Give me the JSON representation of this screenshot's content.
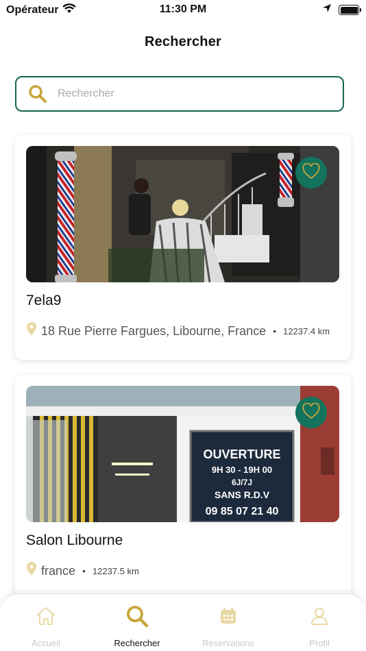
{
  "status_bar": {
    "carrier": "Opérateur",
    "time": "11:30 PM"
  },
  "header": {
    "title": "Rechercher"
  },
  "search": {
    "placeholder": "Rechercher",
    "value": ""
  },
  "salons": [
    {
      "name": "7ela9",
      "address": "18 Rue Pierre Fargues, Libourne, France",
      "separator": "•",
      "distance": "12237.4 km",
      "favorite": false,
      "photo_icon": "barbershop-photo"
    },
    {
      "name": "Salon Libourne",
      "address": "france",
      "separator": "•",
      "distance": "12237.5 km",
      "favorite": false,
      "photo_icon": "storefront-photo",
      "sign": {
        "line1": "OUVERTURE",
        "line2": "9H 30 - 19H 00",
        "line3": "6J/7J",
        "line4": "SANS R.D.V",
        "line5": "09 85 07 21 40"
      }
    }
  ],
  "tab_bar": {
    "items": [
      {
        "label": "Accueil",
        "icon": "home-icon",
        "active": false
      },
      {
        "label": "Rechercher",
        "icon": "search-icon",
        "active": true
      },
      {
        "label": "Réservations",
        "icon": "calendar-icon",
        "active": false
      },
      {
        "label": "Profil",
        "icon": "user-icon",
        "active": false
      }
    ]
  },
  "colors": {
    "accent_green": "#13735d",
    "border_green": "#146454",
    "gold": "#c9a63c",
    "gold_light": "#e8d8a4"
  }
}
